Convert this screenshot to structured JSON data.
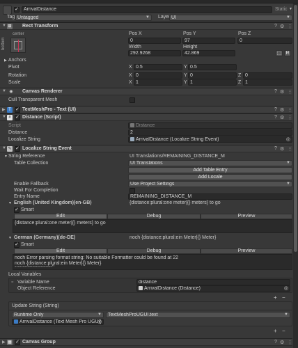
{
  "object": {
    "name": "ArrivalDistance",
    "static_label": "Static",
    "tag_label": "Tag",
    "tag_value": "Untagged",
    "layer_label": "Layer",
    "layer_value": "UI"
  },
  "rect_transform": {
    "title": "Rect Transform",
    "anchor_h": "center",
    "anchor_v": "bottom",
    "pos_x_label": "Pos X",
    "pos_x": "0",
    "pos_y_label": "Pos Y",
    "pos_y": "97",
    "pos_z_label": "Pos Z",
    "pos_z": "0",
    "width_label": "Width",
    "width": "292.9268",
    "height_label": "Height",
    "height": "42.869",
    "anchors_label": "Anchors",
    "pivot_label": "Pivot",
    "pivot_x": "0.5",
    "pivot_y": "0.5",
    "rotation_label": "Rotation",
    "rot_x": "0",
    "rot_y": "0",
    "rot_z": "0",
    "scale_label": "Scale",
    "scale_x": "1",
    "scale_y": "1",
    "scale_z": "1",
    "x": "X",
    "y": "Y",
    "z": "Z",
    "blueprint_btn": "⬚",
    "raw_btn": "R"
  },
  "canvas_renderer": {
    "title": "Canvas Renderer",
    "cull_label": "Cull Transparent Mesh"
  },
  "textmeshpro": {
    "title": "TextMeshPro - Text (UI)"
  },
  "distance_script": {
    "title": "Distance (Script)",
    "script_label": "Script",
    "script_value": "Distance",
    "distance_label": "Distance",
    "distance_value": "2",
    "localize_label": "Localize String",
    "localize_value": "ArrivalDistance (Localize String Event)"
  },
  "localize_event": {
    "title": "Localize String Event",
    "string_ref_label": "String Reference",
    "string_ref_value": "UI Translations/REMAINING_DISTANCE_M",
    "table_collection_label": "Table Collection",
    "table_collection_value": "UI Translations",
    "add_table_entry": "Add Table Entry",
    "add_locale": "Add Locale",
    "enable_fallback_label": "Enable Fallback",
    "enable_fallback_value": "Use Project Settings",
    "wait_label": "Wait For Completion",
    "entry_name_label": "Entry Name",
    "entry_name_value": "REMAINING_DISTANCE_M",
    "english": {
      "label": "English (United Kingdom)(en-GB)",
      "preview": "{distance:plural:one meter|{} meters} to go",
      "smart": "Smart",
      "tab_edit": "Edit",
      "tab_debug": "Debug",
      "tab_preview": "Preview",
      "text": "{distance:plural:one meter|{} meters} to go"
    },
    "german": {
      "label": "German (Germany)(de-DE)",
      "preview": "noch {distance:plural:ein Meter|{} Meter}",
      "smart": "Smart",
      "tab_edit": "Edit",
      "tab_debug": "Debug",
      "tab_preview": "Preview",
      "line1": "noch Error parsing format string: No suitable Formatter could be found at 22",
      "line2": "noch {distance:plural:ein Meter|{} Meter}",
      "line3": "-----------------------^"
    },
    "local_vars": {
      "label": "Local Variables",
      "var_name_label": "Variable Name",
      "var_name_value": "distance",
      "obj_ref_label": "Object Reference",
      "obj_ref_value": "ArrivalDistance (Distance)",
      "plus": "+",
      "minus": "−"
    },
    "update_string": {
      "label": "Update String (String)",
      "runtime_value": "Runtime Only",
      "method_value": "TextMeshProUGUI.text",
      "target_value": "ArrivalDistance (Text Mesh Pro UGUI)",
      "plus": "+",
      "minus": "−"
    }
  },
  "canvas_group": {
    "title": "Canvas Group"
  },
  "icons": {
    "settings": "⚙",
    "more": "⋮",
    "help": "?"
  }
}
